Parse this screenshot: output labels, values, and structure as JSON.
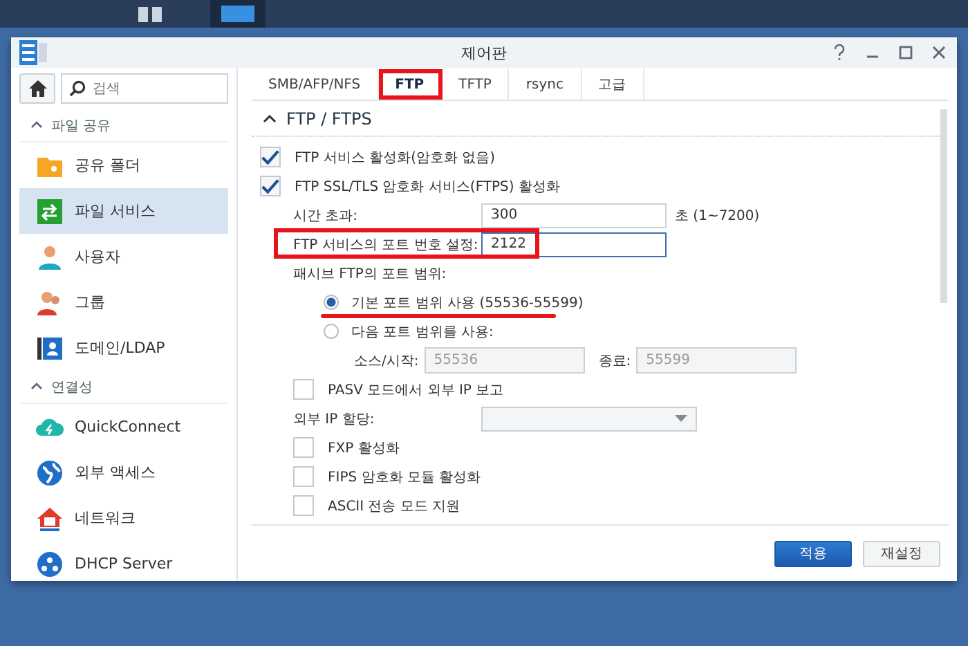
{
  "window": {
    "title": "제어판"
  },
  "sidebar": {
    "search": {
      "placeholder": "검색"
    },
    "sections": [
      {
        "label": "파일 공유",
        "expanded": true,
        "items": [
          {
            "label": "공유 폴더",
            "kind": "folder",
            "selected": false
          },
          {
            "label": "파일 서비스",
            "kind": "file-service",
            "selected": true
          },
          {
            "label": "사용자",
            "kind": "user",
            "selected": false
          },
          {
            "label": "그룹",
            "kind": "group",
            "selected": false
          },
          {
            "label": "도메인/LDAP",
            "kind": "domain",
            "selected": false
          }
        ]
      },
      {
        "label": "연결성",
        "expanded": true,
        "items": [
          {
            "label": "QuickConnect",
            "kind": "cloud",
            "selected": false
          },
          {
            "label": "외부 액세스",
            "kind": "globe",
            "selected": false
          },
          {
            "label": "네트워크",
            "kind": "house",
            "selected": false
          },
          {
            "label": "DHCP Server",
            "kind": "dhcp",
            "selected": false
          }
        ]
      }
    ]
  },
  "tabs": [
    {
      "label": "SMB/AFP/NFS",
      "selected": false,
      "annotated": false
    },
    {
      "label": "FTP",
      "selected": true,
      "annotated": true
    },
    {
      "label": "TFTP",
      "selected": false,
      "annotated": false
    },
    {
      "label": "rsync",
      "selected": false,
      "annotated": false
    },
    {
      "label": "고급",
      "selected": false,
      "annotated": false
    }
  ],
  "section": {
    "title": "FTP / FTPS",
    "expanded": true
  },
  "settings": [
    {
      "kind": "checkbox",
      "label": "FTP 서비스 활성화(암호화 없음)",
      "checked": true
    },
    {
      "kind": "checkbox",
      "label": "FTP SSL/TLS 암호화 서비스(FTPS) 활성화",
      "checked": true,
      "children": [
        {
          "kind": "field",
          "label": "시간 초과:",
          "value": "300",
          "suffix": "초 (1~7200)"
        },
        {
          "kind": "field",
          "label": "FTP 서비스의 포트 번호 설정:",
          "value": "2122",
          "annotated": true
        },
        {
          "kind": "radio-group",
          "label": "패시브 FTP의 포트 범위:",
          "options": [
            {
              "label": "기본 포트 범위 사용 (55536-55599)",
              "selected": true,
              "underlined": true
            },
            {
              "label": "다음 포트 범위를 사용:",
              "selected": false,
              "fields": [
                {
                  "label": "소스/시작:",
                  "value": "55536"
                },
                {
                  "label": "종료:",
                  "value": "55599"
                }
              ]
            }
          ]
        },
        {
          "kind": "checkbox",
          "label": "PASV 모드에서 외부 IP 보고",
          "checked": false
        },
        {
          "kind": "dropdown",
          "label": "외부 IP 할당:"
        },
        {
          "kind": "checkbox",
          "label": "FXP 활성화",
          "checked": false
        },
        {
          "kind": "checkbox",
          "label": "FIPS 암호화 모듈 활성화",
          "checked": false
        },
        {
          "kind": "checkbox",
          "label": "ASCII 전송 모드 지원",
          "checked": false
        }
      ]
    }
  ],
  "buttons": [
    {
      "label": "적용",
      "kind": "primary"
    },
    {
      "label": "재설정",
      "kind": "secondary"
    }
  ]
}
